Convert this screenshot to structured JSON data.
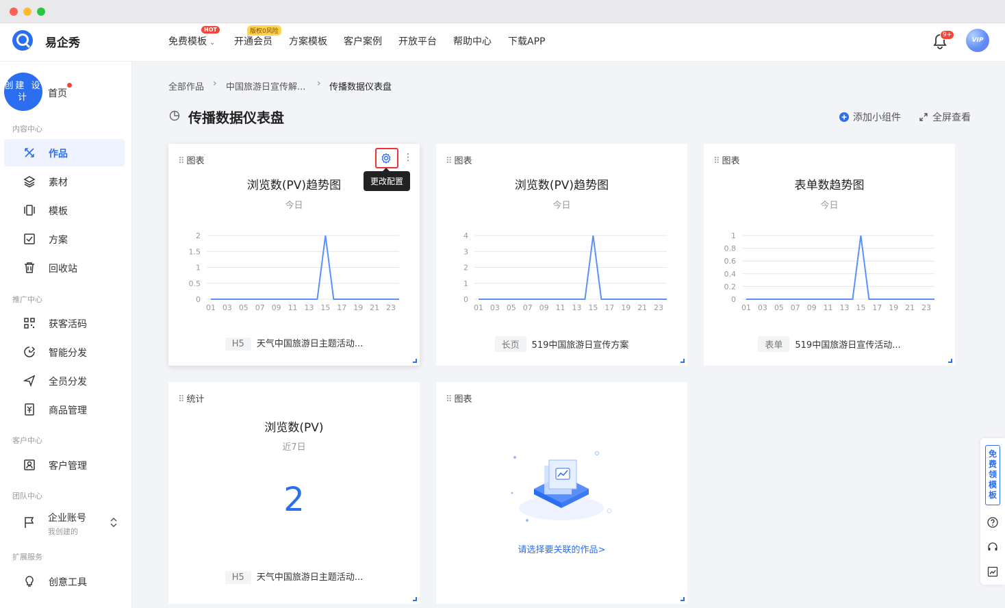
{
  "brand": {
    "name": "易企秀"
  },
  "nav": {
    "items": [
      "免费模板",
      "开通会员",
      "方案模板",
      "客户案例",
      "开放平台",
      "帮助中心",
      "下载APP"
    ],
    "hot_badge": "HOT",
    "vip_badge": "版权0风险"
  },
  "header": {
    "notification_count": "9+",
    "avatar_label": "VIP"
  },
  "sidebar": {
    "create_label": "创建 设计",
    "home": "首页",
    "sections": [
      "内容中心",
      "推广中心",
      "客户中心",
      "团队中心",
      "扩展服务"
    ],
    "items": [
      "作品",
      "素材",
      "模板",
      "方案",
      "回收站",
      "获客活码",
      "智能分发",
      "全员分发",
      "商品管理",
      "客户管理",
      "企业账号",
      "创意工具"
    ],
    "account_sub": "我创建的"
  },
  "breadcrumb": [
    "全部作品",
    "中国旅游日宣传解...",
    "传播数据仪表盘"
  ],
  "page": {
    "title": "传播数据仪表盘",
    "add_widget": "添加小组件",
    "fullscreen": "全屏查看"
  },
  "tooltip": "更改配置",
  "cards": [
    {
      "tag": "图表",
      "title": "浏览数(PV)趋势图",
      "sub": "今日",
      "foot_tag": "H5",
      "foot": "天气中国旅游日主题活动..."
    },
    {
      "tag": "图表",
      "title": "浏览数(PV)趋势图",
      "sub": "今日",
      "foot_tag": "长页",
      "foot": "519中国旅游日宣传方案"
    },
    {
      "tag": "图表",
      "title": "表单数趋势图",
      "sub": "今日",
      "foot_tag": "表单",
      "foot": "519中国旅游日宣传活动..."
    },
    {
      "tag": "统计",
      "title": "浏览数(PV)",
      "sub": "近7日",
      "value": "2",
      "foot_tag": "H5",
      "foot": "天气中国旅游日主题活动..."
    },
    {
      "tag": "图表",
      "link": "请选择要关联的作品>"
    }
  ],
  "rail": {
    "free_template": "免费领模板"
  },
  "chart_data": [
    {
      "type": "line",
      "x": [
        "01",
        "03",
        "05",
        "07",
        "09",
        "11",
        "13",
        "15",
        "17",
        "19",
        "21",
        "23"
      ],
      "yticks": [
        "0",
        "0.5",
        "1",
        "1.5",
        "2"
      ],
      "ylim": [
        0,
        2
      ],
      "peak_at": "15",
      "peak": 2,
      "color": "#5b8ff9"
    },
    {
      "type": "line",
      "x": [
        "01",
        "03",
        "05",
        "07",
        "09",
        "11",
        "13",
        "15",
        "17",
        "19",
        "21",
        "23"
      ],
      "yticks": [
        "0",
        "1",
        "2",
        "3",
        "4"
      ],
      "ylim": [
        0,
        4
      ],
      "peak_at": "15",
      "peak": 4,
      "color": "#5b8ff9"
    },
    {
      "type": "line",
      "x": [
        "01",
        "03",
        "05",
        "07",
        "09",
        "11",
        "13",
        "15",
        "17",
        "19",
        "21",
        "23"
      ],
      "yticks": [
        "0",
        "0.2",
        "0.4",
        "0.6",
        "0.8",
        "1"
      ],
      "ylim": [
        0,
        1
      ],
      "peak_at": "15",
      "peak": 1,
      "color": "#5b8ff9"
    }
  ]
}
